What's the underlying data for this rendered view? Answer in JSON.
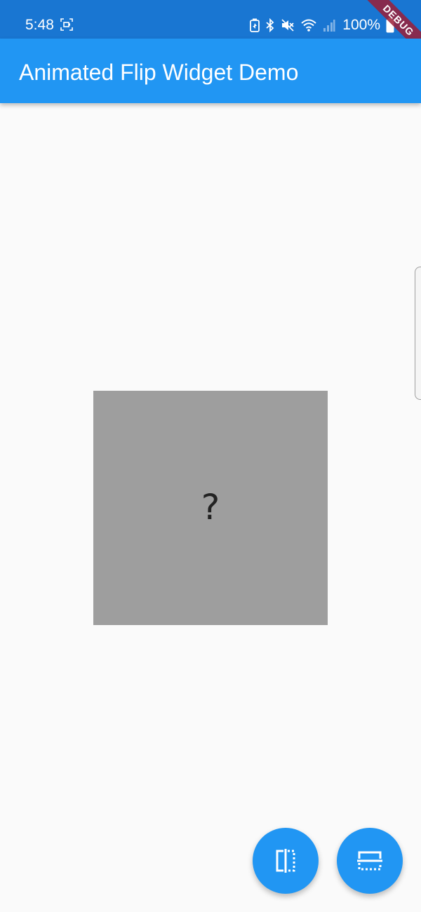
{
  "status_bar": {
    "time": "5:48",
    "battery_percent": "100%",
    "left_icon": "screen-record-icon",
    "right_icons": [
      "battery-saver-icon",
      "bluetooth-icon",
      "mute-icon",
      "wifi-icon",
      "signal-icon",
      "battery-icon"
    ],
    "background_color": "#1976d2"
  },
  "debug_banner": {
    "label": "DEBUG",
    "color": "#9b1e37"
  },
  "app_bar": {
    "title": "Animated Flip Widget Demo",
    "background_color": "#2196f3"
  },
  "flip_card": {
    "text": "?",
    "background_color": "#9e9e9e"
  },
  "fabs": [
    {
      "icon": "flip-horizontal-icon"
    },
    {
      "icon": "flip-vertical-icon"
    }
  ],
  "colors": {
    "accent": "#2196f3",
    "page_background": "#fafafa"
  }
}
